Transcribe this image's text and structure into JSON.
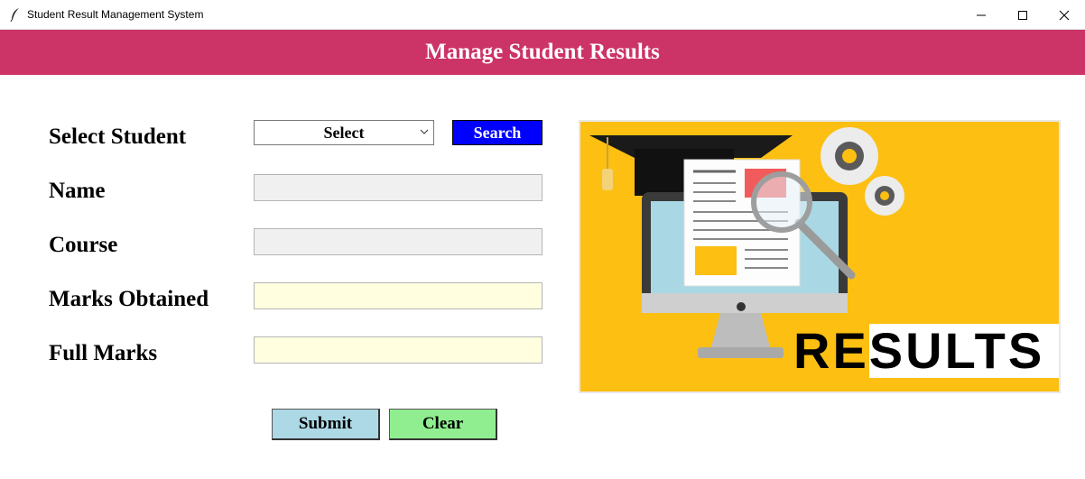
{
  "window": {
    "title": "Student Result Management System"
  },
  "header": {
    "title": "Manage Student Results"
  },
  "form": {
    "select_student_label": "Select Student",
    "select_value": "Select",
    "search_label": "Search",
    "name_label": "Name",
    "course_label": "Course",
    "marks_obtained_label": "Marks Obtained",
    "full_marks_label": "Full Marks",
    "submit_label": "Submit",
    "clear_label": "Clear"
  },
  "image": {
    "text": "RESULTS"
  },
  "colors": {
    "header_bg": "#cc3366",
    "search_bg": "#0000ff",
    "submit_bg": "#add8e6",
    "clear_bg": "#90ee90",
    "readonly_bg": "#f0f0f0",
    "input_bg": "#ffffe0",
    "illustration_bg": "#fcbf12"
  }
}
